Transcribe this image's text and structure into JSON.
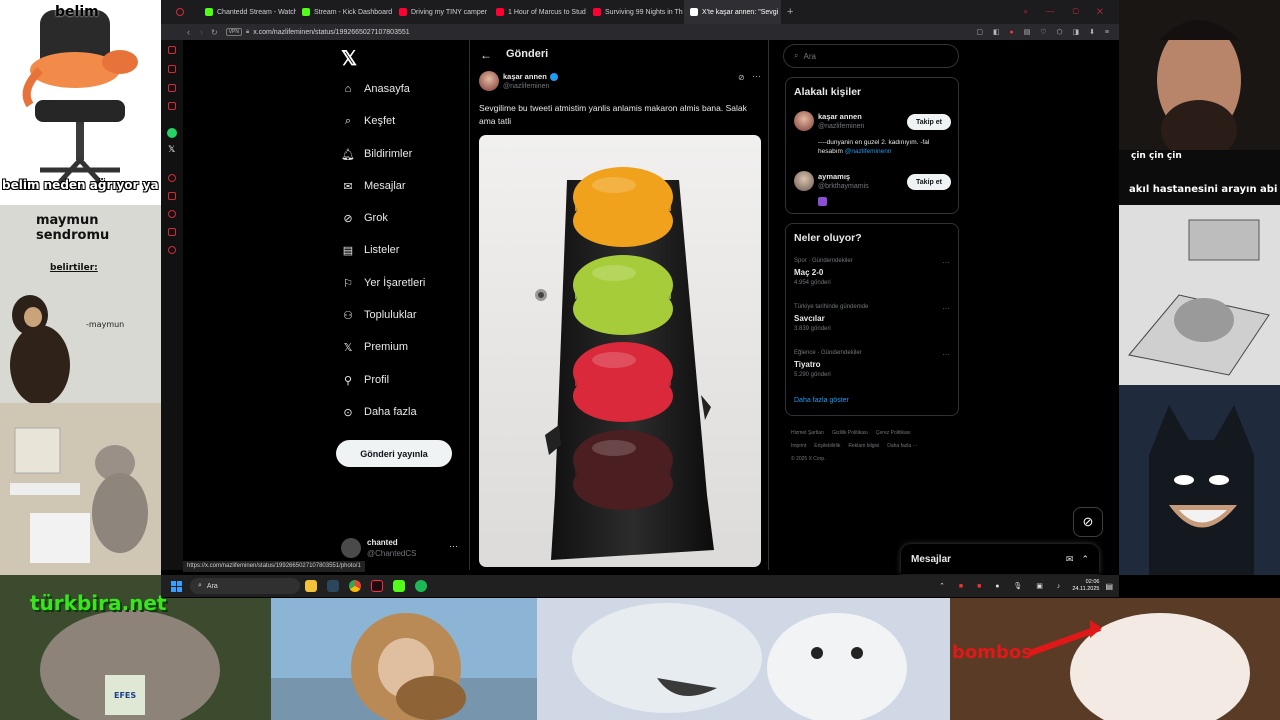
{
  "browser": {
    "tabs": [
      {
        "label": "Chantedd Stream - Watch",
        "color": "#53fc18"
      },
      {
        "label": "Stream - Kick Dashboard",
        "color": "#53fc18"
      },
      {
        "label": "Driving my TINY camper",
        "color": "#ff0033"
      },
      {
        "label": "1 Hour of Marcus to Stud",
        "color": "#ff0033"
      },
      {
        "label": "Surviving 99 Nights in Th",
        "color": "#ff0033"
      },
      {
        "label": "X'te kaşar annen: \"Sevgi",
        "color": "#ffffff",
        "active": true
      }
    ],
    "url": "x.com/nazlifeminen/status/1992665027107803551",
    "vpn": "VPN",
    "status_url": "https://x.com/nazlifeminen/status/1992665027107803551/photo/1"
  },
  "nav": {
    "items": [
      {
        "label": "Anasayfa",
        "icon": "home-icon",
        "bold": true
      },
      {
        "label": "Keşfet",
        "icon": "search-icon"
      },
      {
        "label": "Bildirimler",
        "icon": "bell-icon"
      },
      {
        "label": "Mesajlar",
        "icon": "mail-icon"
      },
      {
        "label": "Grok",
        "icon": "grok-icon"
      },
      {
        "label": "Listeler",
        "icon": "list-icon"
      },
      {
        "label": "Yer İşaretleri",
        "icon": "bookmark-icon"
      },
      {
        "label": "Topluluklar",
        "icon": "communities-icon"
      },
      {
        "label": "Premium",
        "icon": "x-logo-icon"
      },
      {
        "label": "Profil",
        "icon": "profile-icon"
      },
      {
        "label": "Daha fazla",
        "icon": "more-circle-icon"
      }
    ],
    "post_button": "Gönderi yayınla",
    "account_name": "chanted",
    "account_handle": "@ChantedCS"
  },
  "post": {
    "header_title": "Gönderi",
    "author_name": "kaşar annen",
    "author_handle": "@nazlifeminen",
    "text": "Sevgilime bu tweeti atmistim yanlis anlamis makaron almis bana. Salak ama tatli",
    "macaron_colors": [
      "#f0a21c",
      "#a7cc3a",
      "#d9293a",
      "#4b1e22"
    ]
  },
  "right": {
    "search_placeholder": "Ara",
    "related_title": "Alakalı kişiler",
    "people": [
      {
        "name": "kaşar annen",
        "handle": "@nazlifeminen",
        "bio": "----dunyanin en guzel 2. kadınıyım. -fal hesabım",
        "bio_link": "@nazlifeminenn",
        "follow": "Takip et"
      },
      {
        "name": "aymamış",
        "handle": "@brkthaymamis",
        "follow": "Takip et"
      }
    ],
    "trends_title": "Neler oluyor?",
    "trends": [
      {
        "category": "Spor · Gündemdekiler",
        "name": "Maç 2-0",
        "count": "4.954 gönderi"
      },
      {
        "category": "Türkiye tarihinde gündemde",
        "name": "Savcılar",
        "count": "3.839 gönderi"
      },
      {
        "category": "Eğlence · Gündemdekiler",
        "name": "Tiyatro",
        "count": "5.290 gönderi"
      }
    ],
    "show_more": "Daha fazla göster",
    "footer_links": [
      "Hizmet Şartları",
      "Gizlilik Politikası",
      "Çerez Politikası",
      "Imprint",
      "Erişilebilirlik",
      "Reklam bilgisi",
      "Daha fazla ···"
    ],
    "copyright": "© 2025 X Corp.",
    "messages_label": "Mesajlar"
  },
  "taskbar": {
    "search_placeholder": "Ara",
    "time": "02:06",
    "date": "24.11.2025"
  },
  "memes": {
    "shrimp_top": "belim",
    "shrimp_bottom": "belim neden ağrıyor ya",
    "monkey_title": "maymun sendromu",
    "monkey_sub": "belirtiler:",
    "monkey_sig": "-maymun",
    "streamer_caption1": "çin çin çin",
    "streamer_caption2": "akıl hastanesini arayın abi",
    "cat_brand": "türkbira.net",
    "kitten_text": "bombos",
    "glass_label": "EFES"
  }
}
